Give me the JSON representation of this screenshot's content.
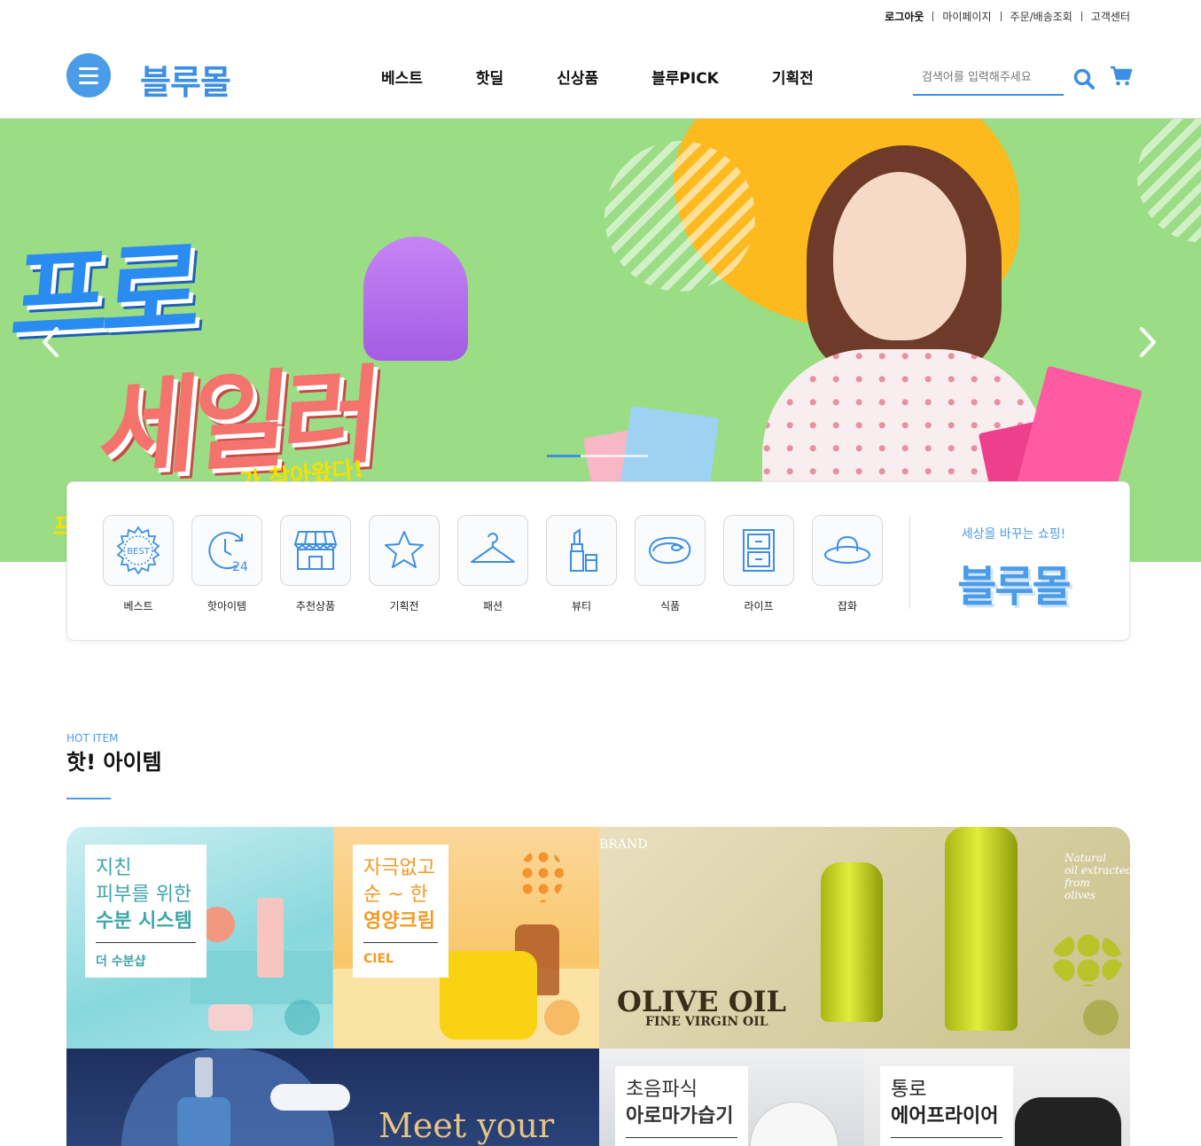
{
  "util_nav": [
    "로그아웃",
    "마이페이지",
    "주문/배송조회",
    "고객센터"
  ],
  "header": {
    "logo": "블루몰",
    "gnb": [
      "베스트",
      "핫딜",
      "신상품",
      "블루PICK",
      "기획전"
    ],
    "search_placeholder": "검색어를 입력해주세요"
  },
  "banner": {
    "headline_1": "프로",
    "headline_2": "세일러",
    "subline": "가 찾아왔다!",
    "subline_2": "프",
    "slide_count": 3,
    "active_slide": 1
  },
  "categories": [
    {
      "label": "베스트",
      "icon": "best-badge-icon"
    },
    {
      "label": "핫아이템",
      "icon": "clock-24-icon"
    },
    {
      "label": "추천상품",
      "icon": "store-icon"
    },
    {
      "label": "기획전",
      "icon": "star-icon"
    },
    {
      "label": "패션",
      "icon": "hanger-icon"
    },
    {
      "label": "뷰티",
      "icon": "lipstick-icon"
    },
    {
      "label": "식품",
      "icon": "steak-icon"
    },
    {
      "label": "라이프",
      "icon": "drawer-icon"
    },
    {
      "label": "잡화",
      "icon": "hat-icon"
    }
  ],
  "brand_box": {
    "slogan": "세상을 바꾸는 쇼핑!",
    "logo": "블루몰"
  },
  "hot_section": {
    "en": "HOT ITEM",
    "ko": "핫! 아이템"
  },
  "tiles": [
    {
      "l1": "지친",
      "l2": "피부를 위한",
      "l3": "수분 시스템",
      "brand": "더 수분샵",
      "accent": "#3fa6a8"
    },
    {
      "l1": "자극없고",
      "l2": "순 ~ 한",
      "l3": "영양크림",
      "brand": "CIEL",
      "accent": "#f39a22"
    },
    {
      "title": "OLIVE OIL",
      "subtitle": "FINE VIRGIN OIL",
      "brand_tag": "BRAND",
      "script_1": "Natural",
      "script_2": "oil extracted from",
      "script_3": "olives"
    },
    {
      "text": "Meet your"
    },
    {
      "l1": "초음파식",
      "l3": "아로마가습기"
    },
    {
      "l1": "통로",
      "l3": "에어프라이어"
    }
  ]
}
